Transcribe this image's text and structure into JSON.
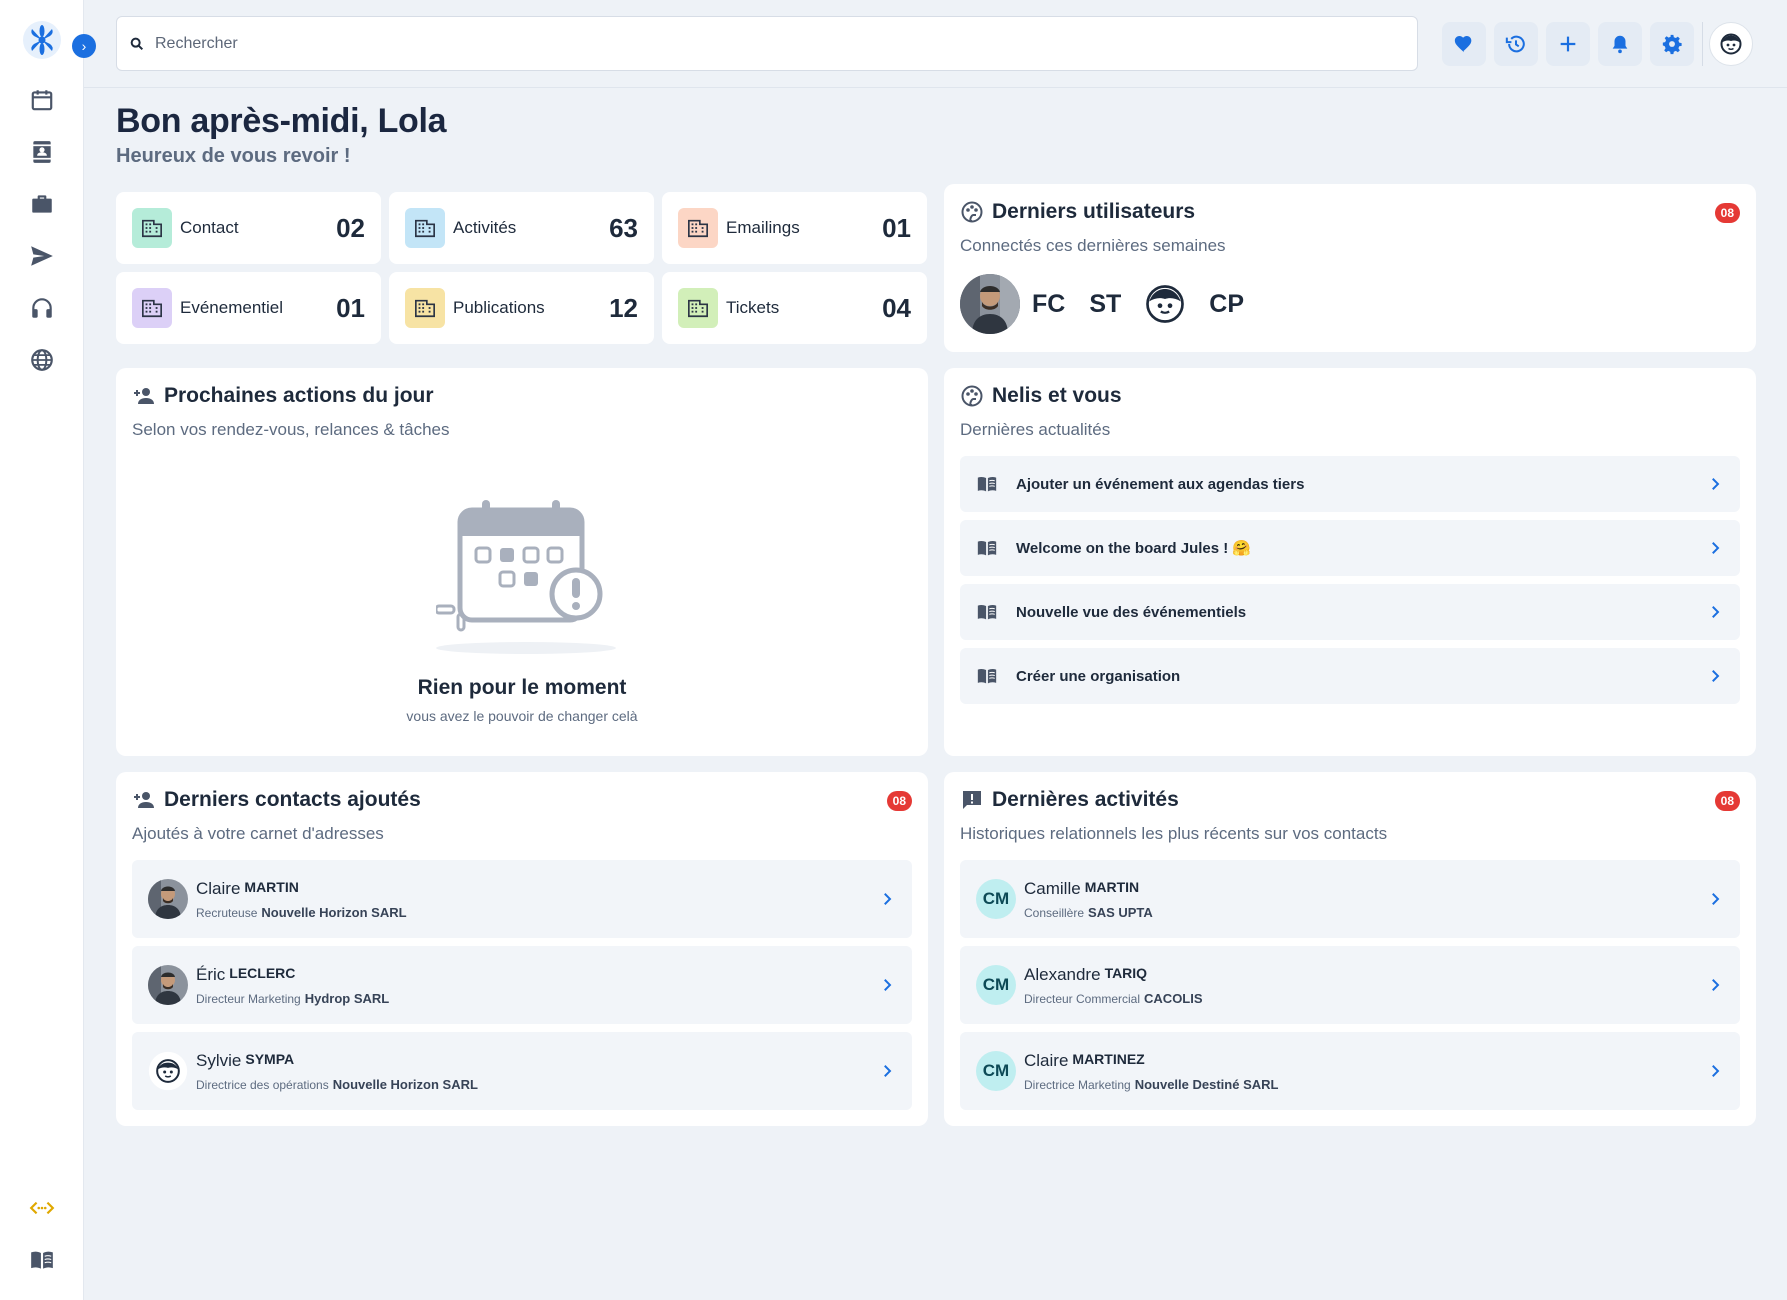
{
  "search": {
    "placeholder": "Rechercher"
  },
  "greeting": {
    "title": "Bon après-midi, Lola",
    "subtitle": "Heureux de vous revoir !"
  },
  "stats": [
    {
      "label": "Contact",
      "value": "02",
      "color": "#b5ecd9"
    },
    {
      "label": "Activités",
      "value": "63",
      "color": "#c3e5f7"
    },
    {
      "label": "Emailings",
      "value": "01",
      "color": "#fcd6c5"
    },
    {
      "label": "Evénementiel",
      "value": "01",
      "color": "#dcd0f7"
    },
    {
      "label": "Publications",
      "value": "12",
      "color": "#f7e3a4"
    },
    {
      "label": "Tickets",
      "value": "04",
      "color": "#d2efb9"
    }
  ],
  "users_panel": {
    "title": "Derniers utilisateurs",
    "subtitle": "Connectés ces dernières semaines",
    "badge": "08",
    "initials": [
      "FC",
      "ST",
      "CP"
    ]
  },
  "actions_panel": {
    "title": "Prochaines actions du jour",
    "subtitle": "Selon vos rendez-vous, relances & tâches",
    "empty_title": "Rien pour le moment",
    "empty_subtitle": "vous avez le pouvoir de changer celà"
  },
  "news_panel": {
    "title": "Nelis et vous",
    "subtitle": "Dernières actualités",
    "items": [
      "Ajouter un événement aux agendas tiers",
      "Welcome on the board Jules ! 🤗",
      "Nouvelle vue des événementiels",
      "Créer une organisation"
    ]
  },
  "contacts_panel": {
    "title": "Derniers contacts ajoutés",
    "subtitle": "Ajoutés à votre carnet d'adresses",
    "badge": "08",
    "rows": [
      {
        "first": "Claire",
        "last": "MARTIN",
        "role": "Recruteuse",
        "org": "Nouvelle Horizon SARL"
      },
      {
        "first": "Éric",
        "last": "LECLERC",
        "role": "Directeur Marketing",
        "org": "Hydrop SARL"
      },
      {
        "first": "Sylvie",
        "last": "SYMPA",
        "role": "Directrice des opérations",
        "org": "Nouvelle Horizon SARL"
      }
    ]
  },
  "activities_panel": {
    "title": "Dernières activités",
    "subtitle": "Historiques relationnels les plus récents sur vos contacts",
    "badge": "08",
    "rows": [
      {
        "initials": "CM",
        "first": "Camille",
        "last": "MARTIN",
        "role": "Conseillère",
        "org": "SAS UPTA"
      },
      {
        "initials": "CM",
        "first": "Alexandre",
        "last": "TARIQ",
        "role": "Directeur Commercial",
        "org": "CACOLIS"
      },
      {
        "initials": "CM",
        "first": "Claire",
        "last": "MARTINEZ",
        "role": "Directrice Marketing",
        "org": "Nouvelle Destiné SARL"
      }
    ]
  },
  "colors": {
    "accent": "#1b6fe0",
    "badge": "#e53935",
    "icon_gray": "#4a5568",
    "dev_icon": "#e0a800"
  }
}
